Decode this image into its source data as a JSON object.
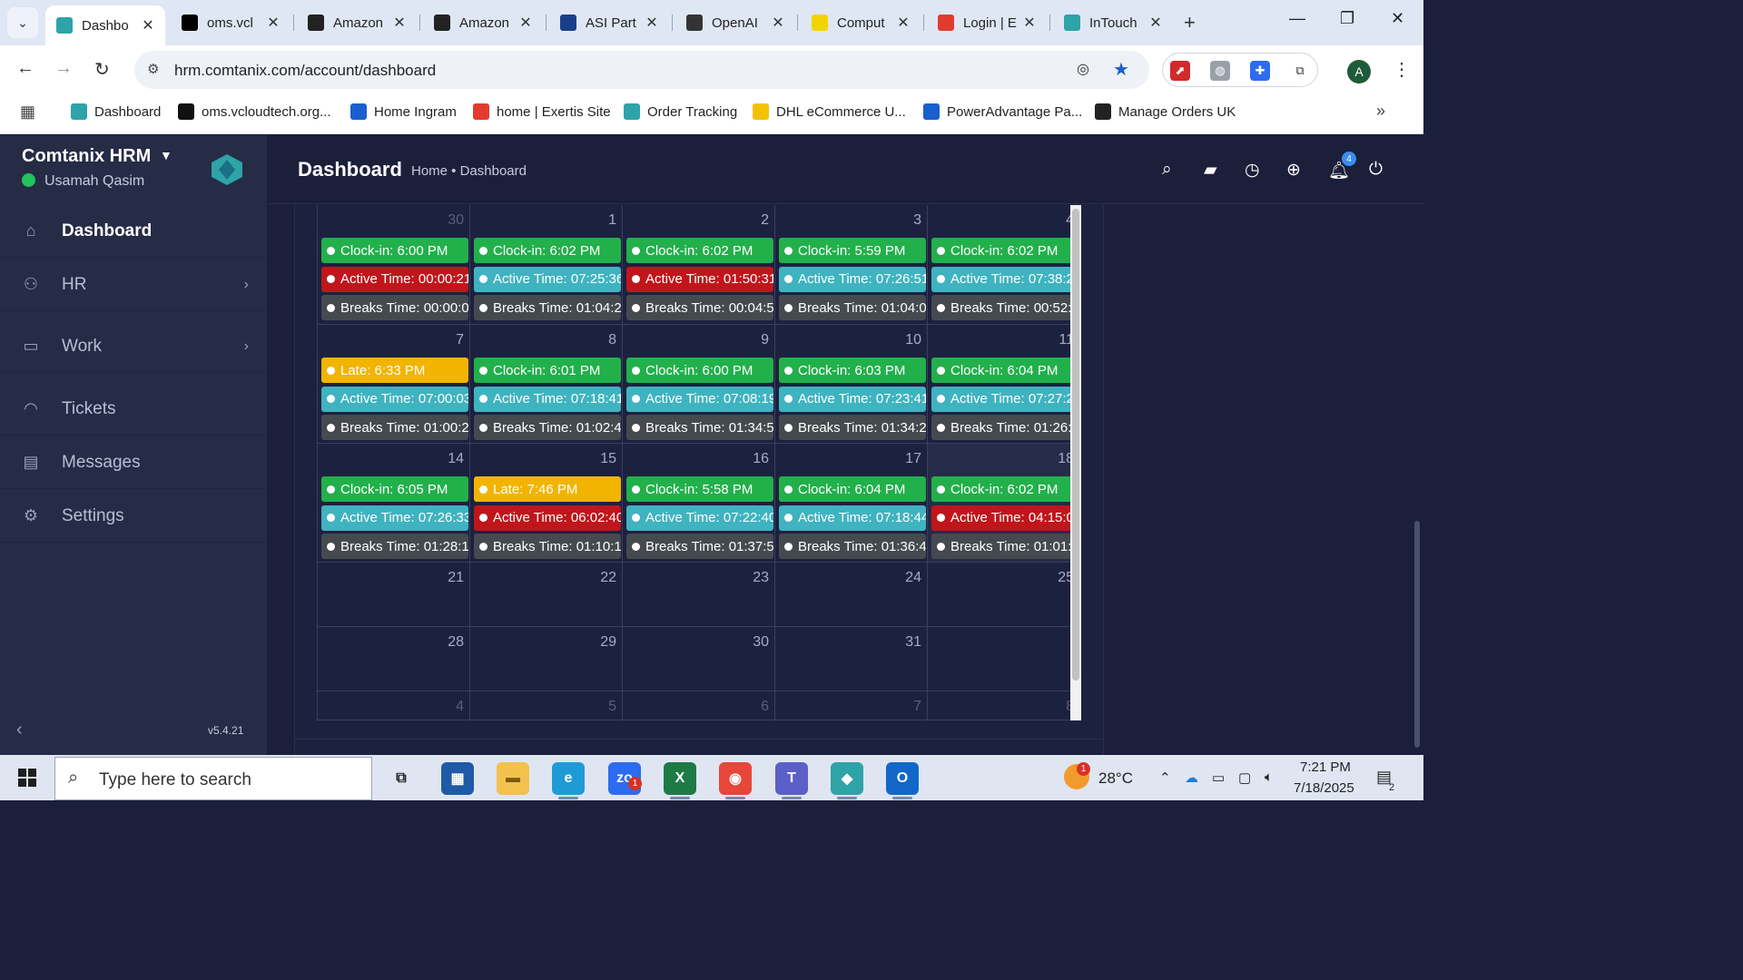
{
  "browser": {
    "tabs": [
      {
        "title": "Dashbo",
        "favicon": "comtanix-icon",
        "color": "#2ea3a8",
        "active": true
      },
      {
        "title": "oms.vcl",
        "favicon": "vcloud-icon",
        "color": "#000000"
      },
      {
        "title": "Amazon",
        "favicon": "amazon-icon",
        "color": "#222222"
      },
      {
        "title": "Amazon",
        "favicon": "amazon-icon",
        "color": "#222222"
      },
      {
        "title": "ASI Part",
        "favicon": "asi-icon",
        "color": "#1a3f8a"
      },
      {
        "title": "OpenAI",
        "favicon": "openai-icon",
        "color": "#333333"
      },
      {
        "title": "Comput",
        "favicon": "computer-icon",
        "color": "#f2d400"
      },
      {
        "title": "Login | E",
        "favicon": "exertis-icon",
        "color": "#e23b2e"
      },
      {
        "title": "InTouch",
        "favicon": "intouch-icon",
        "color": "#2ea3a8"
      }
    ],
    "url": "hrm.comtanix.com/account/dashboard",
    "profile_initial": "A",
    "bookmarks": [
      {
        "label": "Dashboard",
        "color": "#2ea3a8",
        "icon": "comtanix-icon"
      },
      {
        "label": "oms.vcloudtech.org...",
        "color": "#111111",
        "icon": "vcloud-icon"
      },
      {
        "label": "Home Ingram",
        "color": "#1a5fd0",
        "icon": "ingram-icon"
      },
      {
        "label": "home | Exertis Site",
        "color": "#e23b2e",
        "icon": "exertis-icon"
      },
      {
        "label": "Order Tracking",
        "color": "#2ea3a8",
        "icon": "tracking-icon"
      },
      {
        "label": "DHL eCommerce U...",
        "color": "#f2c200",
        "icon": "dhl-icon"
      },
      {
        "label": "PowerAdvantage Pa...",
        "color": "#1a5fd0",
        "icon": "poweradvantage-icon"
      },
      {
        "label": "Manage Orders UK",
        "color": "#222222",
        "icon": "amazon-icon"
      }
    ]
  },
  "app": {
    "brand": "Comtanix HRM",
    "user": "Usamah Qasim",
    "version": "v5.4.21",
    "nav": [
      {
        "label": "Dashboard",
        "icon": "home-icon",
        "active": true,
        "arrow": false
      },
      {
        "label": "HR",
        "icon": "users-icon",
        "active": false,
        "arrow": true
      },
      {
        "label": "Work",
        "icon": "briefcase-icon",
        "active": false,
        "arrow": true
      },
      {
        "label": "Tickets",
        "icon": "headset-icon",
        "active": false,
        "arrow": false
      },
      {
        "label": "Messages",
        "icon": "message-icon",
        "active": false,
        "arrow": false
      },
      {
        "label": "Settings",
        "icon": "gear-icon",
        "active": false,
        "arrow": false
      }
    ],
    "page_title": "Dashboard",
    "breadcrumb": "Home • Dashboard",
    "notification_count": "4"
  },
  "colors": {
    "green": "#22b04b",
    "red": "#c0161b",
    "teal": "#3fb3c0",
    "yellow": "#f2b400",
    "gray": "#454a4f"
  },
  "calendar": {
    "weeks": [
      {
        "days": [
          {
            "num": "30",
            "other": true,
            "events": [
              {
                "text": "Clock-in: 6:00 PM",
                "color": "green"
              },
              {
                "text": "Active Time: 00:00:21",
                "color": "red"
              },
              {
                "text": "Breaks Time: 00:00:00",
                "color": "gray"
              }
            ]
          },
          {
            "num": "1",
            "events": [
              {
                "text": "Clock-in: 6:02 PM",
                "color": "green"
              },
              {
                "text": "Active Time: 07:25:36",
                "color": "teal"
              },
              {
                "text": "Breaks Time: 01:04:20",
                "color": "gray"
              }
            ]
          },
          {
            "num": "2",
            "events": [
              {
                "text": "Clock-in: 6:02 PM",
                "color": "green"
              },
              {
                "text": "Active Time: 01:50:31",
                "color": "red"
              },
              {
                "text": "Breaks Time: 00:04:56",
                "color": "gray"
              }
            ]
          },
          {
            "num": "3",
            "events": [
              {
                "text": "Clock-in: 5:59 PM",
                "color": "green"
              },
              {
                "text": "Active Time: 07:26:51",
                "color": "teal"
              },
              {
                "text": "Breaks Time: 01:04:09",
                "color": "gray"
              }
            ]
          },
          {
            "num": "4",
            "events": [
              {
                "text": "Clock-in: 6:02 PM",
                "color": "green"
              },
              {
                "text": "Active Time: 07:38:2",
                "color": "teal"
              },
              {
                "text": "Breaks Time: 00:52:0",
                "color": "gray"
              }
            ]
          }
        ]
      },
      {
        "days": [
          {
            "num": "7",
            "events": [
              {
                "text": "Late: 6:33 PM",
                "color": "yellow"
              },
              {
                "text": "Active Time: 07:00:03",
                "color": "teal"
              },
              {
                "text": "Breaks Time: 01:00:21",
                "color": "gray"
              }
            ]
          },
          {
            "num": "8",
            "events": [
              {
                "text": "Clock-in: 6:01 PM",
                "color": "green"
              },
              {
                "text": "Active Time: 07:18:41",
                "color": "teal"
              },
              {
                "text": "Breaks Time: 01:02:41",
                "color": "gray"
              }
            ]
          },
          {
            "num": "9",
            "events": [
              {
                "text": "Clock-in: 6:00 PM",
                "color": "green"
              },
              {
                "text": "Active Time: 07:08:19",
                "color": "teal"
              },
              {
                "text": "Breaks Time: 01:34:56",
                "color": "gray"
              }
            ]
          },
          {
            "num": "10",
            "events": [
              {
                "text": "Clock-in: 6:03 PM",
                "color": "green"
              },
              {
                "text": "Active Time: 07:23:41",
                "color": "teal"
              },
              {
                "text": "Breaks Time: 01:34:26",
                "color": "gray"
              }
            ]
          },
          {
            "num": "11",
            "events": [
              {
                "text": "Clock-in: 6:04 PM",
                "color": "green"
              },
              {
                "text": "Active Time: 07:27:2",
                "color": "teal"
              },
              {
                "text": "Breaks Time: 01:26:2",
                "color": "gray"
              }
            ]
          }
        ]
      },
      {
        "days": [
          {
            "num": "14",
            "events": [
              {
                "text": "Clock-in: 6:05 PM",
                "color": "green"
              },
              {
                "text": "Active Time: 07:26:33",
                "color": "teal"
              },
              {
                "text": "Breaks Time: 01:28:16",
                "color": "gray"
              }
            ]
          },
          {
            "num": "15",
            "events": [
              {
                "text": "Late: 7:46 PM",
                "color": "yellow"
              },
              {
                "text": "Active Time: 06:02:40",
                "color": "red"
              },
              {
                "text": "Breaks Time: 01:10:13",
                "color": "gray"
              }
            ]
          },
          {
            "num": "16",
            "events": [
              {
                "text": "Clock-in: 5:58 PM",
                "color": "green"
              },
              {
                "text": "Active Time: 07:22:40",
                "color": "teal"
              },
              {
                "text": "Breaks Time: 01:37:57",
                "color": "gray"
              }
            ]
          },
          {
            "num": "17",
            "events": [
              {
                "text": "Clock-in: 6:04 PM",
                "color": "green"
              },
              {
                "text": "Active Time: 07:18:44",
                "color": "teal"
              },
              {
                "text": "Breaks Time: 01:36:41",
                "color": "gray"
              }
            ]
          },
          {
            "num": "18",
            "today": true,
            "events": [
              {
                "text": "Clock-in: 6:02 PM",
                "color": "green"
              },
              {
                "text": "Active Time: 04:15:0",
                "color": "red"
              },
              {
                "text": "Breaks Time: 01:01:5",
                "color": "gray"
              }
            ]
          }
        ]
      },
      {
        "days": [
          {
            "num": "21",
            "events": []
          },
          {
            "num": "22",
            "events": []
          },
          {
            "num": "23",
            "events": []
          },
          {
            "num": "24",
            "events": []
          },
          {
            "num": "25",
            "events": []
          }
        ]
      },
      {
        "days": [
          {
            "num": "28",
            "events": []
          },
          {
            "num": "29",
            "events": []
          },
          {
            "num": "30",
            "events": []
          },
          {
            "num": "31",
            "events": []
          },
          {
            "num": "",
            "events": []
          }
        ]
      },
      {
        "days": [
          {
            "num": "4",
            "other": true,
            "events": []
          },
          {
            "num": "5",
            "other": true,
            "events": []
          },
          {
            "num": "6",
            "other": true,
            "events": []
          },
          {
            "num": "7",
            "other": true,
            "events": []
          },
          {
            "num": "8",
            "other": true,
            "events": []
          }
        ]
      }
    ]
  },
  "taskbar": {
    "search_placeholder": "Type here to search",
    "apps": [
      {
        "name": "task-view-icon",
        "label": "⧉",
        "color": "#dfe6f2",
        "text": "#222"
      },
      {
        "name": "calculator-icon",
        "label": "▦",
        "color": "#1e5aa8",
        "text": "#fff"
      },
      {
        "name": "file-explorer-icon",
        "label": "▬",
        "color": "#f2c14e",
        "text": "#7a5a10"
      },
      {
        "name": "edge-icon",
        "label": "e",
        "color": "#1e9bd7",
        "text": "#fff"
      },
      {
        "name": "zoom-icon",
        "label": "zo",
        "color": "#2d6cf0",
        "text": "#fff"
      },
      {
        "name": "excel-icon",
        "label": "X",
        "color": "#1e7a45",
        "text": "#fff"
      },
      {
        "name": "chrome-icon",
        "label": "◉",
        "color": "#e7463a",
        "text": "#fff"
      },
      {
        "name": "teams-icon",
        "label": "T",
        "color": "#5b5fc7",
        "text": "#fff"
      },
      {
        "name": "comtanix-app-icon",
        "label": "◆",
        "color": "#2ea3a8",
        "text": "#fff"
      },
      {
        "name": "outlook-icon",
        "label": "O",
        "color": "#1168c8",
        "text": "#fff"
      }
    ],
    "weather": "28°C",
    "weather_badge": "1",
    "zoom_badge": "1",
    "time": "7:21 PM",
    "date": "7/18/2025",
    "notif_count": "2"
  }
}
